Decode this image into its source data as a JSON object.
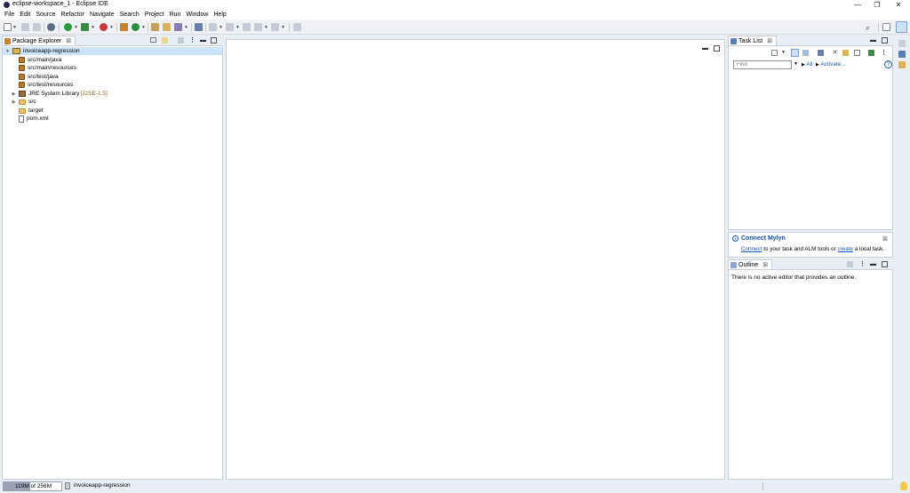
{
  "window": {
    "title": "eclipse-workspace_1 - Eclipse IDE",
    "minimize": "—",
    "restore": "❐",
    "close": "✕"
  },
  "menu": [
    "File",
    "Edit",
    "Source",
    "Refactor",
    "Navigate",
    "Search",
    "Project",
    "Run",
    "Window",
    "Help"
  ],
  "package_explorer": {
    "tab_label": "Package Explorer",
    "close_glyph": "⊠",
    "tree": [
      {
        "label": "invoiceapp-regression",
        "icon": "project-icon",
        "expanded": true,
        "selected": true
      },
      {
        "label": "src/main/java",
        "icon": "package-folder-icon"
      },
      {
        "label": "src/main/resources",
        "icon": "package-folder-icon"
      },
      {
        "label": "src/test/java",
        "icon": "package-folder-icon"
      },
      {
        "label": "src/test/resources",
        "icon": "package-folder-icon"
      },
      {
        "label": "JRE System Library",
        "suffix": "[J2SE-1.5]",
        "icon": "library-icon"
      },
      {
        "label": "src",
        "icon": "folder-icon"
      },
      {
        "label": "target",
        "icon": "folder-icon"
      },
      {
        "label": "pom.xml",
        "icon": "xml-file-icon"
      }
    ]
  },
  "task_list": {
    "tab_label": "Task List",
    "find_placeholder": "Find",
    "all_label": "All",
    "activate_label": "Activate...",
    "help_glyph": "?"
  },
  "mylyn": {
    "title": "Connect Mylyn",
    "connect_link": "Connect",
    "text_middle": " to your task and ALM tools or ",
    "create_link": "create",
    "text_end": " a local task."
  },
  "outline": {
    "tab_label": "Outline",
    "message": "There is no active editor that provides an outline."
  },
  "status": {
    "heap_label": "119M of 256M",
    "heap_used_fraction": 0.46,
    "selected_item": "invoiceapp-regression"
  },
  "colors": {
    "selection": "#cde3f7",
    "accent_blue": "#1a55b8",
    "panel_border": "#c9ced9",
    "background": "#e9edf4"
  }
}
